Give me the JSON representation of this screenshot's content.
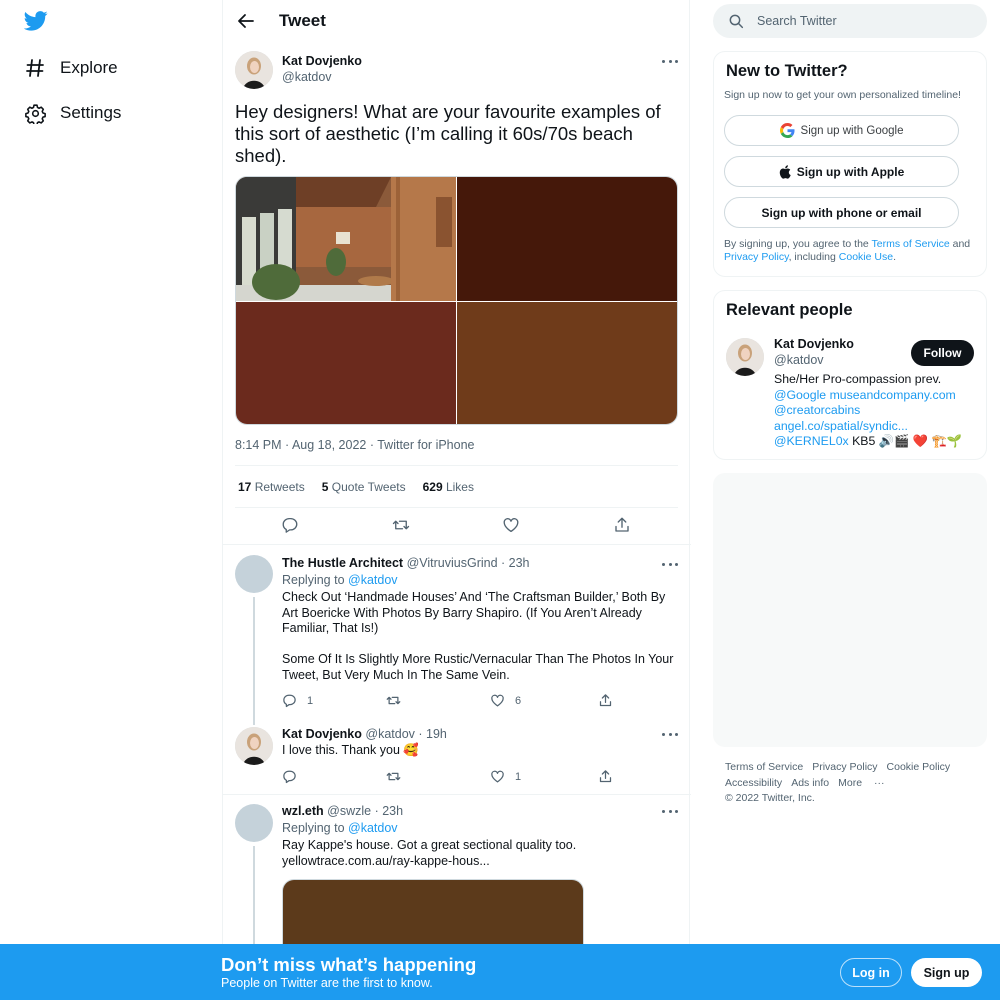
{
  "brand": {
    "accent": "#1d9bf0",
    "logo_icon": "twitter-bird-icon"
  },
  "nav": {
    "items": [
      {
        "label": "Explore",
        "icon": "hashtag-icon"
      },
      {
        "label": "Settings",
        "icon": "gear-icon"
      }
    ]
  },
  "header": {
    "title": "Tweet"
  },
  "tweet": {
    "author_name": "Kat Dovjenko",
    "author_handle": "@katdov",
    "text": "Hey designers! What are your favourite examples of this sort of aesthetic (I’m calling it 60s/70s beach shed).",
    "media_colors": [
      "#45180a",
      "#6b2a1d",
      "#6f3b1a"
    ],
    "timestamp": "8:14 PM · Aug 18, 2022 · Twitter for iPhone",
    "stats": {
      "retweets_count": "17",
      "retweets_label": "Retweets",
      "quotes_count": "5",
      "quotes_label": "Quote Tweets",
      "likes_count": "629",
      "likes_label": "Likes"
    }
  },
  "replies": [
    {
      "name": "The Hustle Architect",
      "meta": "@VitruviusGrind · 23h",
      "replying_prefix": "Replying to",
      "replying_to": "@katdov",
      "text_p1": "Check Out ‘Handmade Houses’ And ‘The Craftsman Builder,’ Both By Art Boericke With Photos By Barry Shapiro. (If You Aren’t Already Familiar, That Is!)",
      "text_p2": "Some Of It Is Slightly More Rustic/Vernacular Than The Photos In Your Tweet, But Very Much In The Same Vein.",
      "reply_count": "1",
      "retweet_count": "",
      "like_count": "6"
    },
    {
      "name": "Kat Dovjenko",
      "meta": "@katdov · 19h",
      "text": "I love this. Thank you 🥰",
      "reply_count": "",
      "retweet_count": "",
      "like_count": "1"
    },
    {
      "name": "wzl.eth",
      "meta": "@swzle · 23h",
      "replying_prefix": "Replying to",
      "replying_to": "@katdov",
      "text": "Ray Kappe's house. Got a great sectional quality too.",
      "link": "yellowtrace.com.au/ray-kappe-hous...",
      "media_color": "#5c3a1b"
    }
  ],
  "search": {
    "placeholder": "Search Twitter"
  },
  "new_to_twitter": {
    "title": "New to Twitter?",
    "subtitle": "Sign up now to get your own personalized timeline!",
    "google_label": "Sign up with Google",
    "apple_label": "Sign up with Apple",
    "phone_label": "Sign up with phone or email",
    "fine_1": "By signing up, you agree to the ",
    "terms": "Terms of Service",
    "fine_2": " and ",
    "privacy": "Privacy Policy",
    "fine_3": ", including ",
    "cookie": "Cookie Use",
    "fine_4": "."
  },
  "relevant_people": {
    "title": "Relevant people",
    "name": "Kat Dovjenko",
    "handle": "@katdov",
    "follow_label": "Follow",
    "bio_line1": "She/Her Pro-compassion prev.",
    "bio_mention1": "@Google",
    "bio_link1": "museandcompany.com",
    "bio_mention2": "@creatorcabins",
    "bio_link2": "angel.co/spatial/syndic...",
    "bio_mention3": "@KERNEL0x",
    "bio_tail": " KB5 🔊🎬 ❤️ 🏗️🌱"
  },
  "footer": {
    "terms": "Terms of Service",
    "privacy": "Privacy Policy",
    "cookie": "Cookie Policy",
    "accessibility": "Accessibility",
    "ads": "Ads info",
    "more": "More",
    "copyright": "© 2022 Twitter, Inc."
  },
  "bottom_bar": {
    "title": "Don’t miss what’s happening",
    "subtitle": "People on Twitter are the first to know.",
    "login_label": "Log in",
    "signup_label": "Sign up"
  }
}
